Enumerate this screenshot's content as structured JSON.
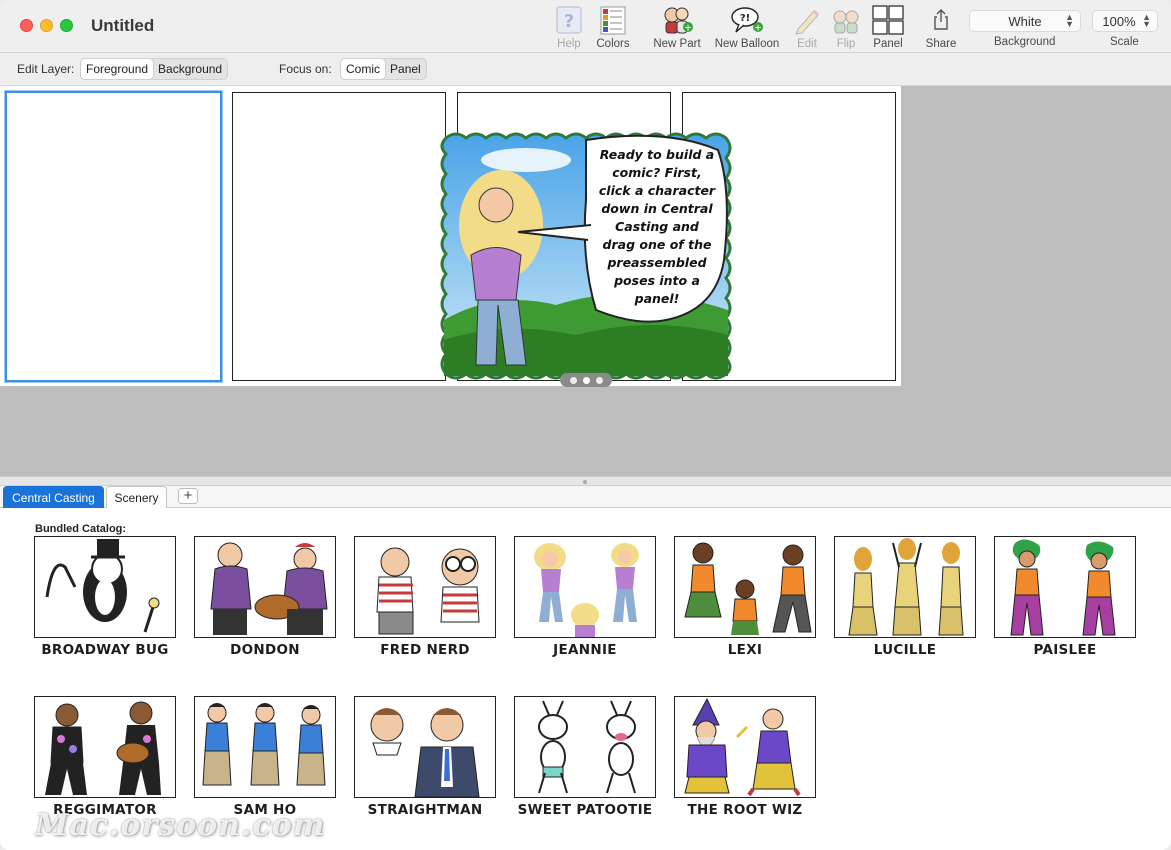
{
  "window": {
    "title": "Untitled"
  },
  "toolbar": {
    "items": [
      {
        "label": "Help",
        "icon": "help-icon",
        "enabled": false
      },
      {
        "label": "Colors",
        "icon": "colors-icon",
        "enabled": true
      },
      {
        "label": "New Part",
        "icon": "new-part-icon",
        "enabled": true
      },
      {
        "label": "New Balloon",
        "icon": "new-balloon-icon",
        "enabled": true
      },
      {
        "label": "Edit",
        "icon": "edit-pencil-icon",
        "enabled": false
      },
      {
        "label": "Flip",
        "icon": "flip-icon",
        "enabled": false
      },
      {
        "label": "Panel",
        "icon": "panel-layout-icon",
        "enabled": true
      },
      {
        "label": "Share",
        "icon": "share-icon",
        "enabled": true
      }
    ],
    "background": {
      "value": "White",
      "label": "Background"
    },
    "scale": {
      "value": "100%",
      "label": "Scale"
    }
  },
  "layerbar": {
    "edit_layer_label": "Edit Layer:",
    "edit_layer_options": [
      "Foreground",
      "Background"
    ],
    "edit_layer_selected": "Foreground",
    "focus_label": "Focus on:",
    "focus_options": [
      "Comic",
      "Panel"
    ],
    "focus_selected": "Comic"
  },
  "onboarding": {
    "text": "Ready to build a comic? First, click a character down in Central Casting and drag one of the preassembled poses into a panel!",
    "pages": 3,
    "current_page": 2
  },
  "tabs": {
    "items": [
      "Central Casting",
      "Scenery"
    ],
    "active": "Central Casting",
    "add_label": "+"
  },
  "catalog": {
    "heading": "Bundled Catalog:",
    "characters": [
      "BROADWAY BUG",
      "DONDON",
      "FRED NERD",
      "JEANNIE",
      "LEXI",
      "LUCILLE",
      "PAISLEE",
      "REGGIMATOR",
      "SAM HO",
      "STRAIGHTMAN",
      "SWEET PATOOTIE",
      "THE ROOT WIZ"
    ]
  },
  "watermark": "Mac.orsoon.com",
  "colors": {
    "accent": "#1a73d8",
    "canvas_bg": "#bdbdbd",
    "selected_panel": "#3a8ee6",
    "bubble_border": "#2f7a3a"
  }
}
